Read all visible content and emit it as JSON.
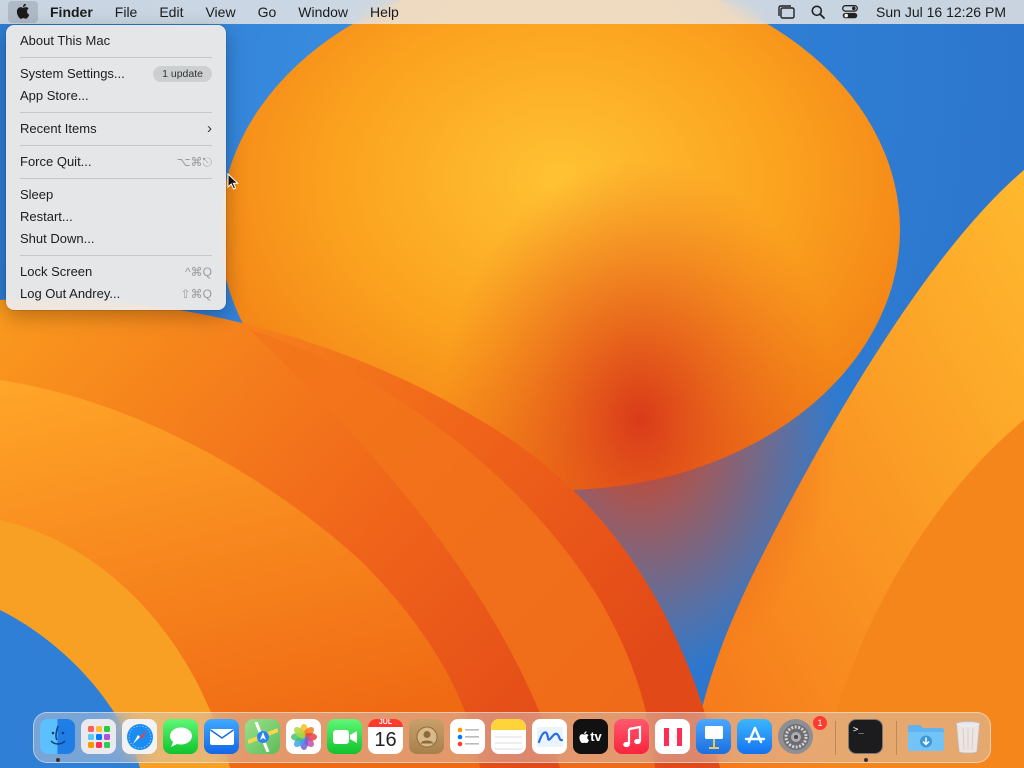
{
  "menubar": {
    "app_name": "Finder",
    "menus": [
      "File",
      "Edit",
      "View",
      "Go",
      "Window",
      "Help"
    ],
    "clock": "Sun Jul 16  12:26 PM"
  },
  "apple_menu": {
    "about": "About This Mac",
    "system_settings": "System Settings...",
    "update_badge": "1 update",
    "app_store": "App Store...",
    "recent_items": "Recent Items",
    "recent_chevron": "›",
    "force_quit": "Force Quit...",
    "force_quit_shortcut": "⌥⌘⎋",
    "sleep": "Sleep",
    "restart": "Restart...",
    "shut_down": "Shut Down...",
    "lock_screen": "Lock Screen",
    "lock_shortcut": "^⌘Q",
    "log_out": "Log Out Andrey...",
    "log_out_shortcut": "⇧⌘Q"
  },
  "dock": {
    "calendar_month": "JUL",
    "calendar_day": "16",
    "tv_label": "tv",
    "settings_badge": "1",
    "terminal_prompt": ">_"
  },
  "colors": {
    "accent": "#0a84ff",
    "wallpaper_orange": "#f59a1e",
    "wallpaper_blue": "#2f7fd6"
  }
}
